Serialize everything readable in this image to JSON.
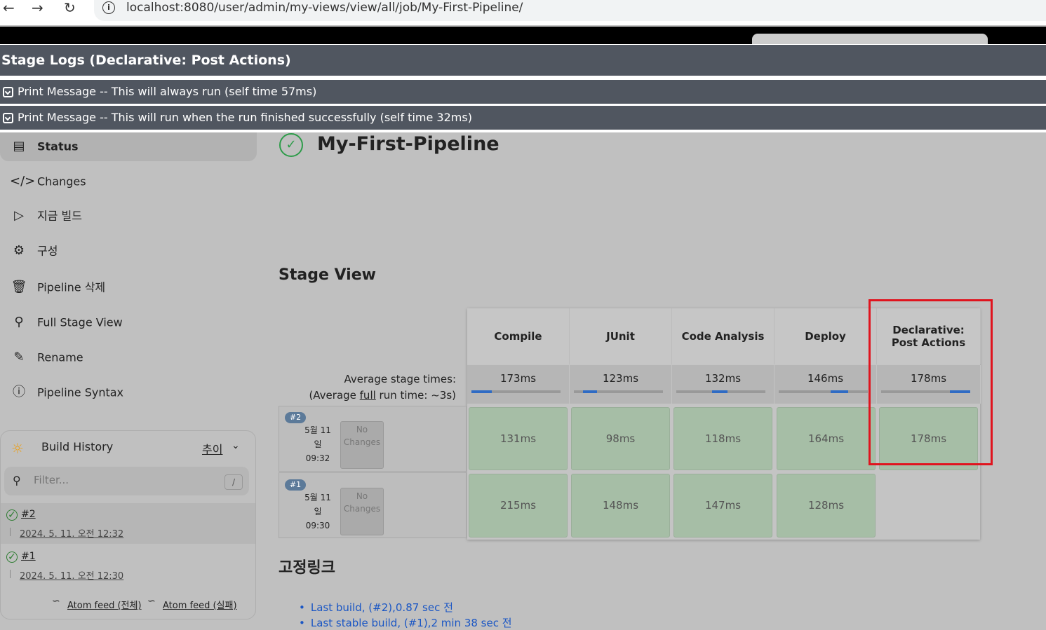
{
  "browser": {
    "url": "localhost:8080/user/admin/my-views/view/all/job/My-First-Pipeline/"
  },
  "stage_logs": {
    "title": "Stage Logs (Declarative: Post Actions)",
    "rows": [
      "Print Message -- This will always run (self time 57ms)",
      "Print Message -- This will run when the run finished successfully (self time 32ms)"
    ]
  },
  "sidebar": {
    "items": [
      {
        "label": "Status",
        "icon": "document-icon"
      },
      {
        "label": "Changes",
        "icon": "code-icon"
      },
      {
        "label": "지금 빌드",
        "icon": "play-icon"
      },
      {
        "label": "구성",
        "icon": "gear-icon"
      },
      {
        "label": "Pipeline 삭제",
        "icon": "trash-icon"
      },
      {
        "label": "Full Stage View",
        "icon": "search-icon"
      },
      {
        "label": "Rename",
        "icon": "pencil-icon"
      },
      {
        "label": "Pipeline Syntax",
        "icon": "help-icon"
      }
    ]
  },
  "build_history": {
    "title": "Build History",
    "trend": "추이",
    "filter_placeholder": "Filter...",
    "filter_shortcut": "/",
    "builds": [
      {
        "number": "#2",
        "date": "2024. 5. 11. 오전 12:32"
      },
      {
        "number": "#1",
        "date": "2024. 5. 11. 오전 12:30"
      }
    ],
    "atom_all": "Atom feed (전체)",
    "atom_fail": "Atom feed (실패)"
  },
  "main": {
    "title": "My-First-Pipeline",
    "stage_view_title": "Stage View",
    "avg_stage_label": "Average stage times:",
    "avg_run_prefix": "(Average ",
    "avg_run_link": "full",
    "avg_run_suffix": " run time: ~3s)",
    "stages": [
      {
        "name": "Compile",
        "avg": "173ms",
        "bar": 0.23
      },
      {
        "name": "JUnit",
        "avg": "123ms",
        "bar": 0.16
      },
      {
        "name": "Code Analysis",
        "avg": "132ms",
        "bar": 0.17
      },
      {
        "name": "Deploy",
        "avg": "146ms",
        "bar": 0.2
      },
      {
        "name": "Declarative: Post Actions",
        "name_line1": "Declarative:",
        "name_line2": "Post Actions",
        "avg": "178ms",
        "bar": 0.23
      }
    ],
    "runs": [
      {
        "badge": "#2",
        "date_line1": "5월 11",
        "date_line2": "일",
        "time": "09:32",
        "changes_line1": "No",
        "changes_line2": "Changes",
        "times": [
          "131ms",
          "98ms",
          "118ms",
          "164ms",
          "178ms"
        ]
      },
      {
        "badge": "#1",
        "date_line1": "5월 11",
        "date_line2": "일",
        "time": "09:30",
        "changes_line1": "No",
        "changes_line2": "Changes",
        "times": [
          "215ms",
          "148ms",
          "147ms",
          "128ms"
        ]
      }
    ],
    "permalinks_title": "고정링크",
    "permalinks": [
      "Last build, (#2),0.87 sec 전",
      "Last stable build, (#1),2 min 38 sec 전"
    ]
  },
  "colors": {
    "overlay": "#505660",
    "success": "#a6bea6",
    "highlight": "#e0141e",
    "link": "#1a56c4"
  }
}
